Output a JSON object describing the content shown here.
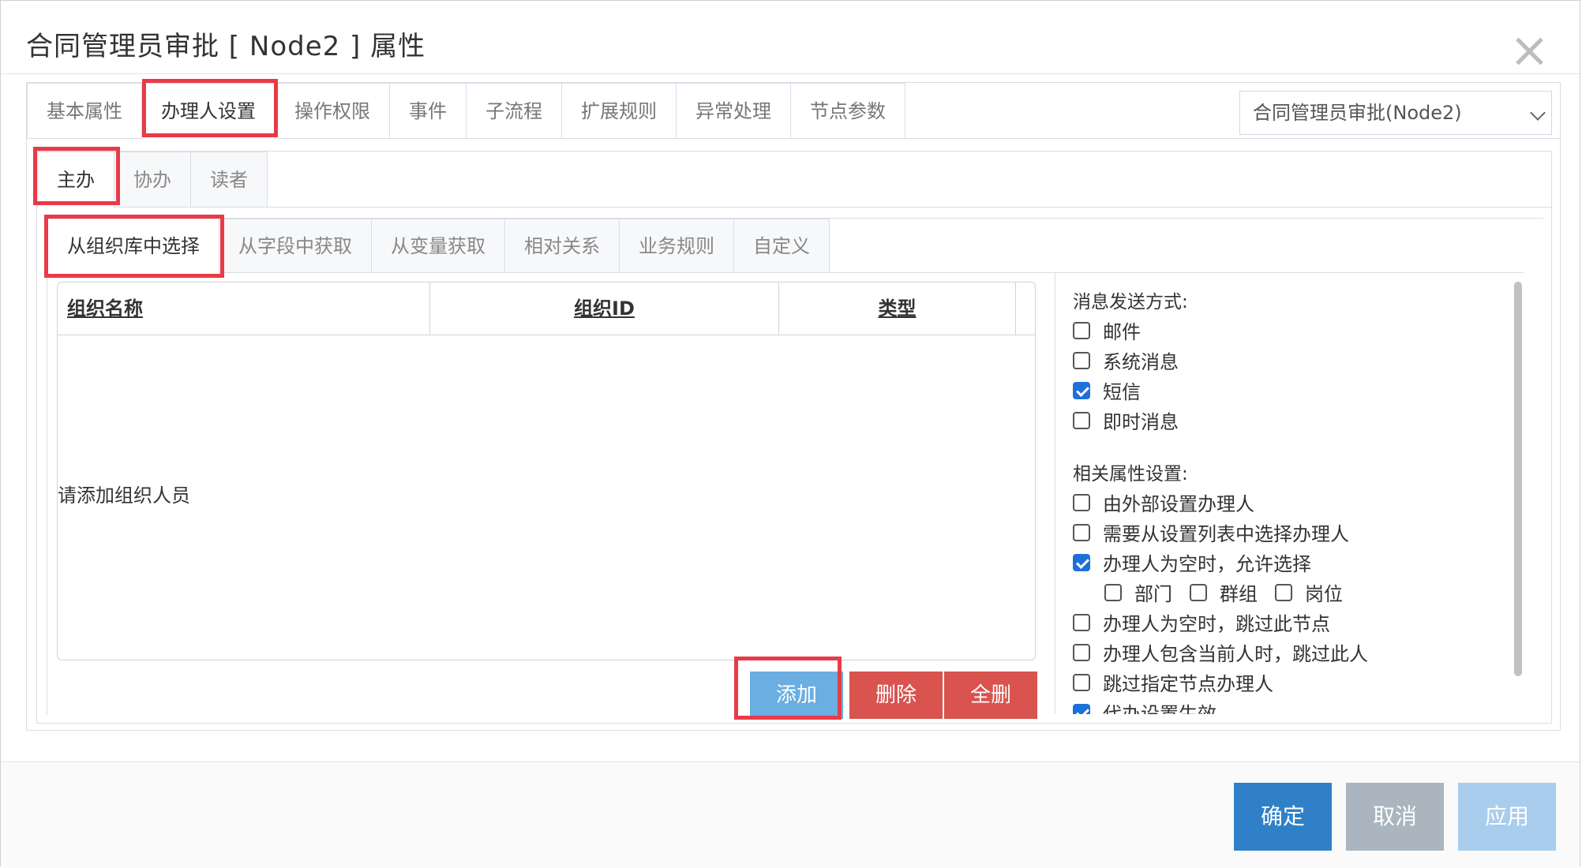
{
  "dialog": {
    "title": "合同管理员审批 [ Node2 ] 属性"
  },
  "main_tabs": [
    {
      "label": "基本属性"
    },
    {
      "label": "办理人设置"
    },
    {
      "label": "操作权限"
    },
    {
      "label": "事件"
    },
    {
      "label": "子流程"
    },
    {
      "label": "扩展规则"
    },
    {
      "label": "异常处理"
    },
    {
      "label": "节点参数"
    }
  ],
  "node_select": {
    "value": "合同管理员审批(Node2)"
  },
  "role_tabs": [
    {
      "label": "主办"
    },
    {
      "label": "协办"
    },
    {
      "label": "读者"
    }
  ],
  "source_tabs": [
    {
      "label": "从组织库中选择"
    },
    {
      "label": "从字段中获取"
    },
    {
      "label": "从变量获取"
    },
    {
      "label": "相对关系"
    },
    {
      "label": "业务规则"
    },
    {
      "label": "自定义"
    }
  ],
  "grid": {
    "columns": [
      "组织名称",
      "组织ID",
      "类型"
    ],
    "empty_text": "请添加组织人员"
  },
  "grid_buttons": {
    "add": "添加",
    "delete": "删除",
    "delete_all": "全删"
  },
  "message_section": {
    "label": "消息发送方式:",
    "options": [
      {
        "label": "邮件",
        "checked": false
      },
      {
        "label": "系统消息",
        "checked": false
      },
      {
        "label": "短信",
        "checked": true
      },
      {
        "label": "即时消息",
        "checked": false
      }
    ]
  },
  "related_section": {
    "label": "相关属性设置:",
    "options": [
      {
        "label": "由外部设置办理人",
        "checked": false
      },
      {
        "label": "需要从设置列表中选择办理人",
        "checked": false
      },
      {
        "label": "办理人为空时，允许选择",
        "checked": true
      },
      {
        "label": "办理人为空时，跳过此节点",
        "checked": false
      },
      {
        "label": "办理人包含当前人时，跳过此人",
        "checked": false
      },
      {
        "label": "跳过指定节点办理人",
        "checked": false
      },
      {
        "label": "代办设置生效",
        "checked": true
      }
    ],
    "sub_options": [
      {
        "label": "部门",
        "checked": false
      },
      {
        "label": "群组",
        "checked": false
      },
      {
        "label": "岗位",
        "checked": false
      }
    ]
  },
  "footer": {
    "ok": "确定",
    "cancel": "取消",
    "apply": "应用"
  },
  "colors": {
    "highlight": "#e83b47",
    "primary": "#2f80c7",
    "danger": "#d9534f",
    "checkbox_on": "#1e6fd9"
  }
}
